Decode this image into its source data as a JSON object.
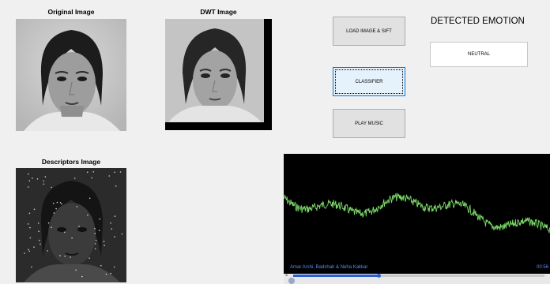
{
  "panels": {
    "original": {
      "title": "Original Image"
    },
    "dwt": {
      "title": "DWT Image"
    },
    "descriptors": {
      "title": "Descriptors Image"
    }
  },
  "buttons": {
    "load": "LOAD IMAGE & SIFT",
    "classifier": "CLASSIFIER",
    "play": "PLAY MUSIC"
  },
  "emotion": {
    "title": "DETECTED EMOTION",
    "value": "NEUTRAL"
  },
  "player": {
    "media_title": "Amar Arshi, Badshah & Neha Kakkar",
    "time": "00:56",
    "progress": 0.34,
    "accent_color": "#5d8cf0",
    "wave_color": "#7ddc6a"
  },
  "icons": {
    "play": "play-icon",
    "seek_start": "seek-start-icon"
  }
}
